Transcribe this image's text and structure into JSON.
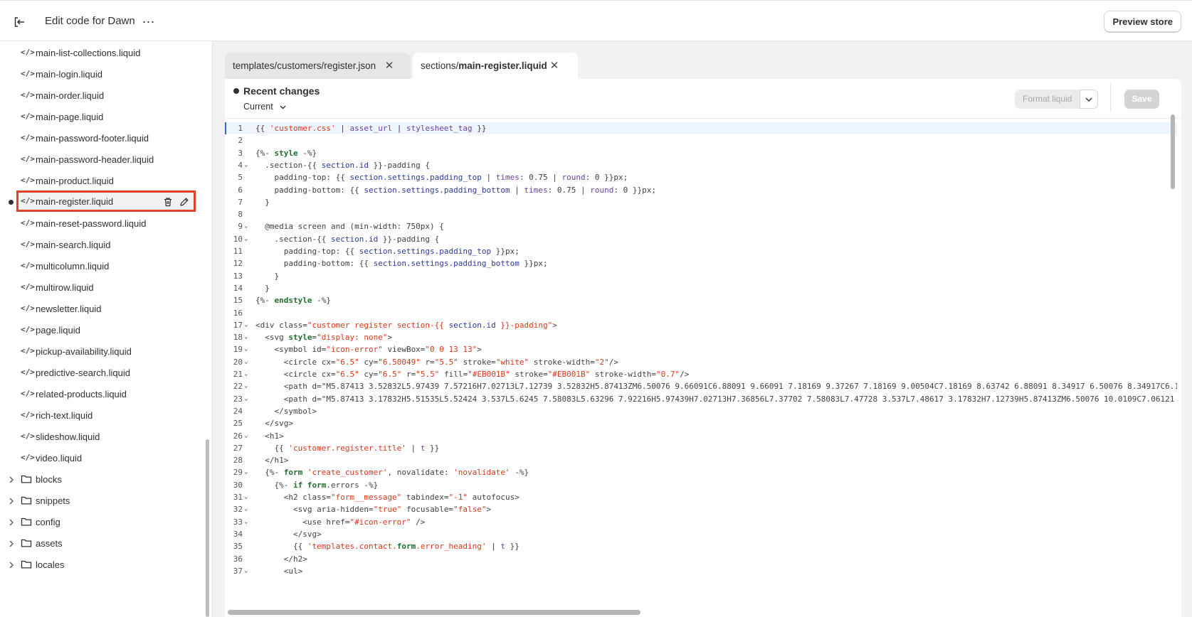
{
  "header": {
    "title": "Edit code for Dawn",
    "preview_label": "Preview store"
  },
  "sidebar": {
    "files": [
      "main-list-collections.liquid",
      "main-login.liquid",
      "main-order.liquid",
      "main-page.liquid",
      "main-password-footer.liquid",
      "main-password-header.liquid",
      "main-product.liquid",
      "main-register.liquid",
      "main-reset-password.liquid",
      "main-search.liquid",
      "multicolumn.liquid",
      "multirow.liquid",
      "newsletter.liquid",
      "page.liquid",
      "pickup-availability.liquid",
      "predictive-search.liquid",
      "related-products.liquid",
      "rich-text.liquid",
      "slideshow.liquid",
      "video.liquid"
    ],
    "selected_file": "main-register.liquid",
    "folders": [
      "blocks",
      "snippets",
      "config",
      "assets",
      "locales"
    ]
  },
  "tabs": [
    {
      "label": "templates/customers/register.json"
    },
    {
      "prefix": "sections/",
      "name": "main-register.liquid"
    }
  ],
  "editor": {
    "recent_changes": "Recent changes",
    "version": "Current",
    "format_label": "Format liquid",
    "save_label": "Save"
  },
  "code_lines": [
    "{{ 'customer.css' | asset_url | stylesheet_tag }}",
    "",
    "{%- style -%}",
    "  .section-{{ section.id }}-padding {",
    "    padding-top: {{ section.settings.padding_top | times: 0.75 | round: 0 }}px;",
    "    padding-bottom: {{ section.settings.padding_bottom | times: 0.75 | round: 0 }}px;",
    "  }",
    "",
    "  @media screen and (min-width: 750px) {",
    "    .section-{{ section.id }}-padding {",
    "      padding-top: {{ section.settings.padding_top }}px;",
    "      padding-bottom: {{ section.settings.padding_bottom }}px;",
    "    }",
    "  }",
    "{%- endstyle -%}",
    "",
    "<div class=\"customer register section-{{ section.id }}-padding\">",
    "  <svg style=\"display: none\">",
    "    <symbol id=\"icon-error\" viewBox=\"0 0 13 13\">",
    "      <circle cx=\"6.5\" cy=\"6.50049\" r=\"5.5\" stroke=\"white\" stroke-width=\"2\"/>",
    "      <circle cx=\"6.5\" cy=\"6.5\" r=\"5.5\" fill=\"#EB001B\" stroke=\"#EB001B\" stroke-width=\"0.7\"/>",
    "      <path d=\"M5.87413 3.52832L5.97439 7.57216H7.02713L7.12739 3.52832H5.87413ZM6.50076 9.66091C6.88091 9.66091 7.18169 9.37267 7.18169 9.00504C7.18169 8.63742 6.88091 8.34917 6.50076 8.34917C6.12",
    "      <path d=\"M5.87413 3.17832H5.51535L5.52424 3.537L5.6245 7.58083L5.63296 7.92216H5.97439H7.02713H7.36856L7.37702 7.58083L7.47728 3.537L7.48617 3.17832H7.12739H5.87413ZM6.50076 10.0109C7.06121 10",
    "    </symbol>",
    "  </svg>",
    "  <h1>",
    "    {{ 'customer.register.title' | t }}",
    "  </h1>",
    "  {%- form 'create_customer', novalidate: 'novalidate' -%}",
    "    {%- if form.errors -%}",
    "      <h2 class=\"form__message\" tabindex=\"-1\" autofocus>",
    "        <svg aria-hidden=\"true\" focusable=\"false\">",
    "          <use href=\"#icon-error\" />",
    "        </svg>",
    "        {{ 'templates.contact.form.error_heading' | t }}",
    "      </h2>",
    "      <ul>"
  ],
  "fold_lines": [
    4,
    9,
    10,
    17,
    18,
    19,
    20,
    21,
    22,
    23,
    26,
    29,
    31,
    32,
    33,
    37
  ],
  "colors": {
    "accent_red": "#e0412a",
    "code_string": "#d6361c",
    "code_keyword": "#1f6e2f",
    "code_purple": "#6b3fa3",
    "code_blue": "#2b3a98"
  }
}
